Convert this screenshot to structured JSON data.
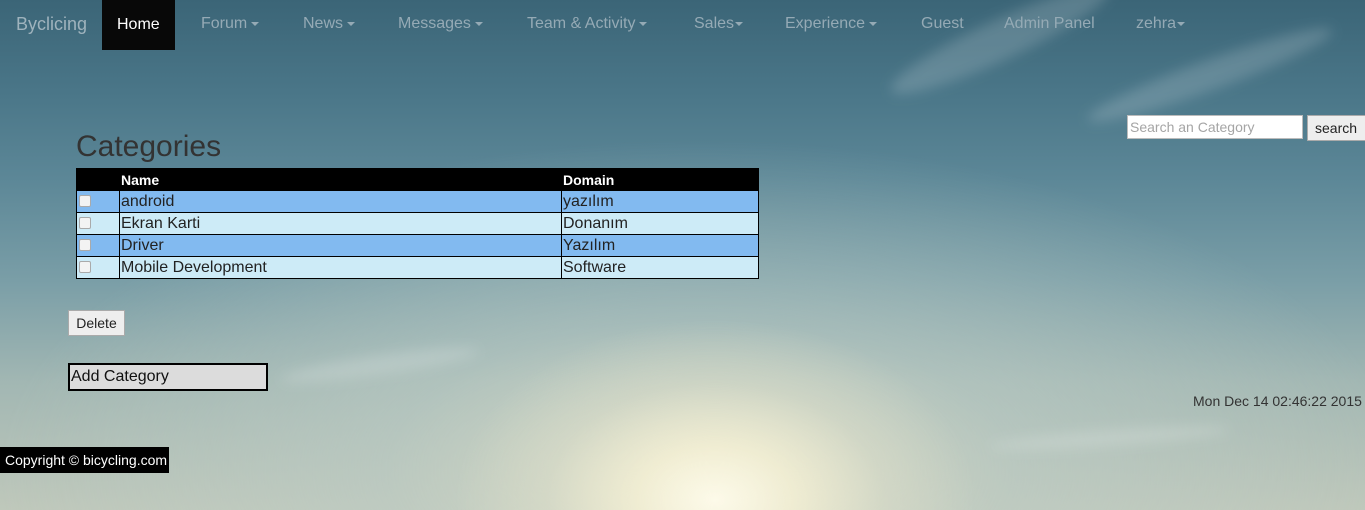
{
  "navbar": {
    "brand": "Byclicing",
    "items": [
      {
        "label": "Home",
        "dropdown": false,
        "active": true
      },
      {
        "label": "Forum",
        "dropdown": true
      },
      {
        "label": "News",
        "dropdown": true
      },
      {
        "label": "Messages",
        "dropdown": true
      },
      {
        "label": "Team & Activity",
        "dropdown": true
      },
      {
        "label": "Sales",
        "dropdown": true
      },
      {
        "label": "Experience",
        "dropdown": true
      },
      {
        "label": "Guest",
        "dropdown": false
      },
      {
        "label": "Admin Panel",
        "dropdown": false
      },
      {
        "label": "zehra",
        "dropdown": true
      }
    ]
  },
  "search": {
    "placeholder": "Search an Category",
    "value": "",
    "button_label": "search"
  },
  "main": {
    "title": "Categories",
    "table": {
      "columns": [
        "",
        "Name",
        "Domain"
      ],
      "rows": [
        {
          "checked": false,
          "name": "android",
          "domain": "yazılım"
        },
        {
          "checked": false,
          "name": "Ekran Karti",
          "domain": "Donanım"
        },
        {
          "checked": false,
          "name": "Driver",
          "domain": "Yazılım"
        },
        {
          "checked": false,
          "name": "Mobile Development",
          "domain": "Software"
        }
      ]
    },
    "delete_label": "Delete",
    "add_category_label": "Add Category"
  },
  "timestamp": "Mon Dec 14 02:46:22 2015",
  "footer": {
    "copyright": "Copyright © bicycling.com"
  },
  "colors": {
    "active_nav_bg": "#080808",
    "row_odd": "#82baf0",
    "row_even": "#cdebf7",
    "table_header_bg": "#000000"
  }
}
